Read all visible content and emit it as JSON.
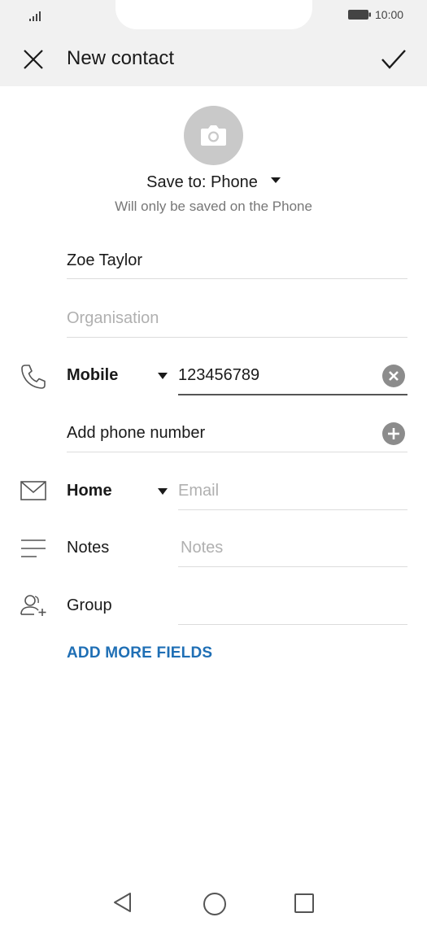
{
  "status_bar": {
    "time": "10:00"
  },
  "header": {
    "title": "New contact"
  },
  "save_to": {
    "label": "Save to: Phone",
    "subtitle": "Will only be saved on the Phone"
  },
  "fields": {
    "name": {
      "value": "Zoe Taylor"
    },
    "organisation": {
      "placeholder": "Organisation"
    },
    "phone": {
      "type_label": "Mobile",
      "value": "123456789"
    },
    "add_phone": {
      "label": "Add phone number"
    },
    "email": {
      "type_label": "Home",
      "placeholder": "Email"
    },
    "notes": {
      "label": "Notes",
      "placeholder": "Notes"
    },
    "group": {
      "label": "Group"
    }
  },
  "add_more_fields": {
    "label": "ADD MORE FIELDS"
  },
  "icons": {
    "close": "close-icon",
    "confirm": "check-icon",
    "camera": "camera-icon",
    "phone": "phone-icon",
    "email": "mail-icon",
    "notes": "notes-icon",
    "group": "group-add-icon",
    "clear": "clear-icon",
    "add": "add-circle-icon"
  },
  "colors": {
    "accent": "#1f6fb5",
    "header_bg": "#f1f1f1",
    "avatar_bg": "#c9c9c9"
  }
}
